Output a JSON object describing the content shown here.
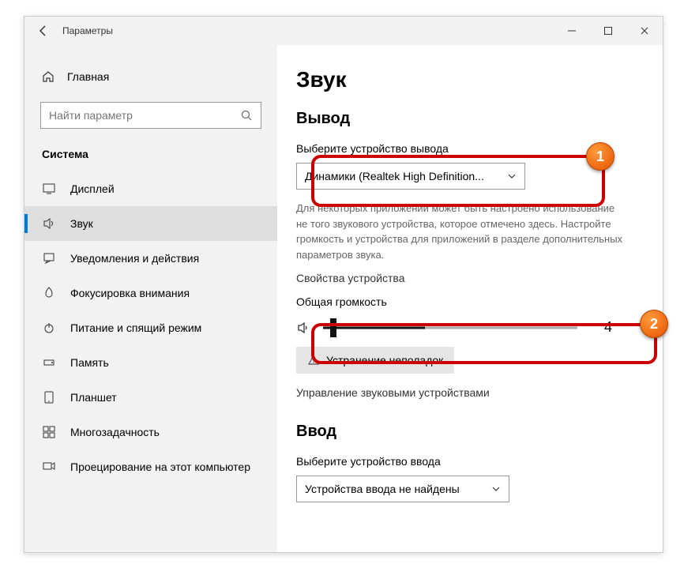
{
  "window": {
    "title": "Параметры"
  },
  "sidebar": {
    "home": "Главная",
    "search_placeholder": "Найти параметр",
    "category": "Система",
    "items": [
      {
        "label": "Дисплей",
        "icon": "display"
      },
      {
        "label": "Звук",
        "icon": "sound"
      },
      {
        "label": "Уведомления и действия",
        "icon": "notif"
      },
      {
        "label": "Фокусировка внимания",
        "icon": "focus"
      },
      {
        "label": "Питание и спящий режим",
        "icon": "power"
      },
      {
        "label": "Память",
        "icon": "storage"
      },
      {
        "label": "Планшет",
        "icon": "tablet"
      },
      {
        "label": "Многозадачность",
        "icon": "multitask"
      },
      {
        "label": "Проецирование на этот компьютер",
        "icon": "project"
      }
    ]
  },
  "main": {
    "title": "Звук",
    "output_heading": "Вывод",
    "output_label": "Выберите устройство вывода",
    "output_device": "Динамики (Realtek High Definition...",
    "output_desc": "Для некоторых приложений может быть настроено использование не того звукового устройства, которое отмечено здесь. Настройте громкость и устройства для приложений в разделе дополнительных параметров звука.",
    "device_props": "Свойства устройства",
    "master_vol_label": "Общая громкость",
    "volume": 4,
    "troubleshoot": "Устранение неполадок",
    "manage_devices": "Управление звуковыми устройствами",
    "input_heading": "Ввод",
    "input_label": "Выберите устройство ввода",
    "input_device": "Устройства ввода не найдены"
  },
  "callouts": {
    "one": "1",
    "two": "2"
  }
}
